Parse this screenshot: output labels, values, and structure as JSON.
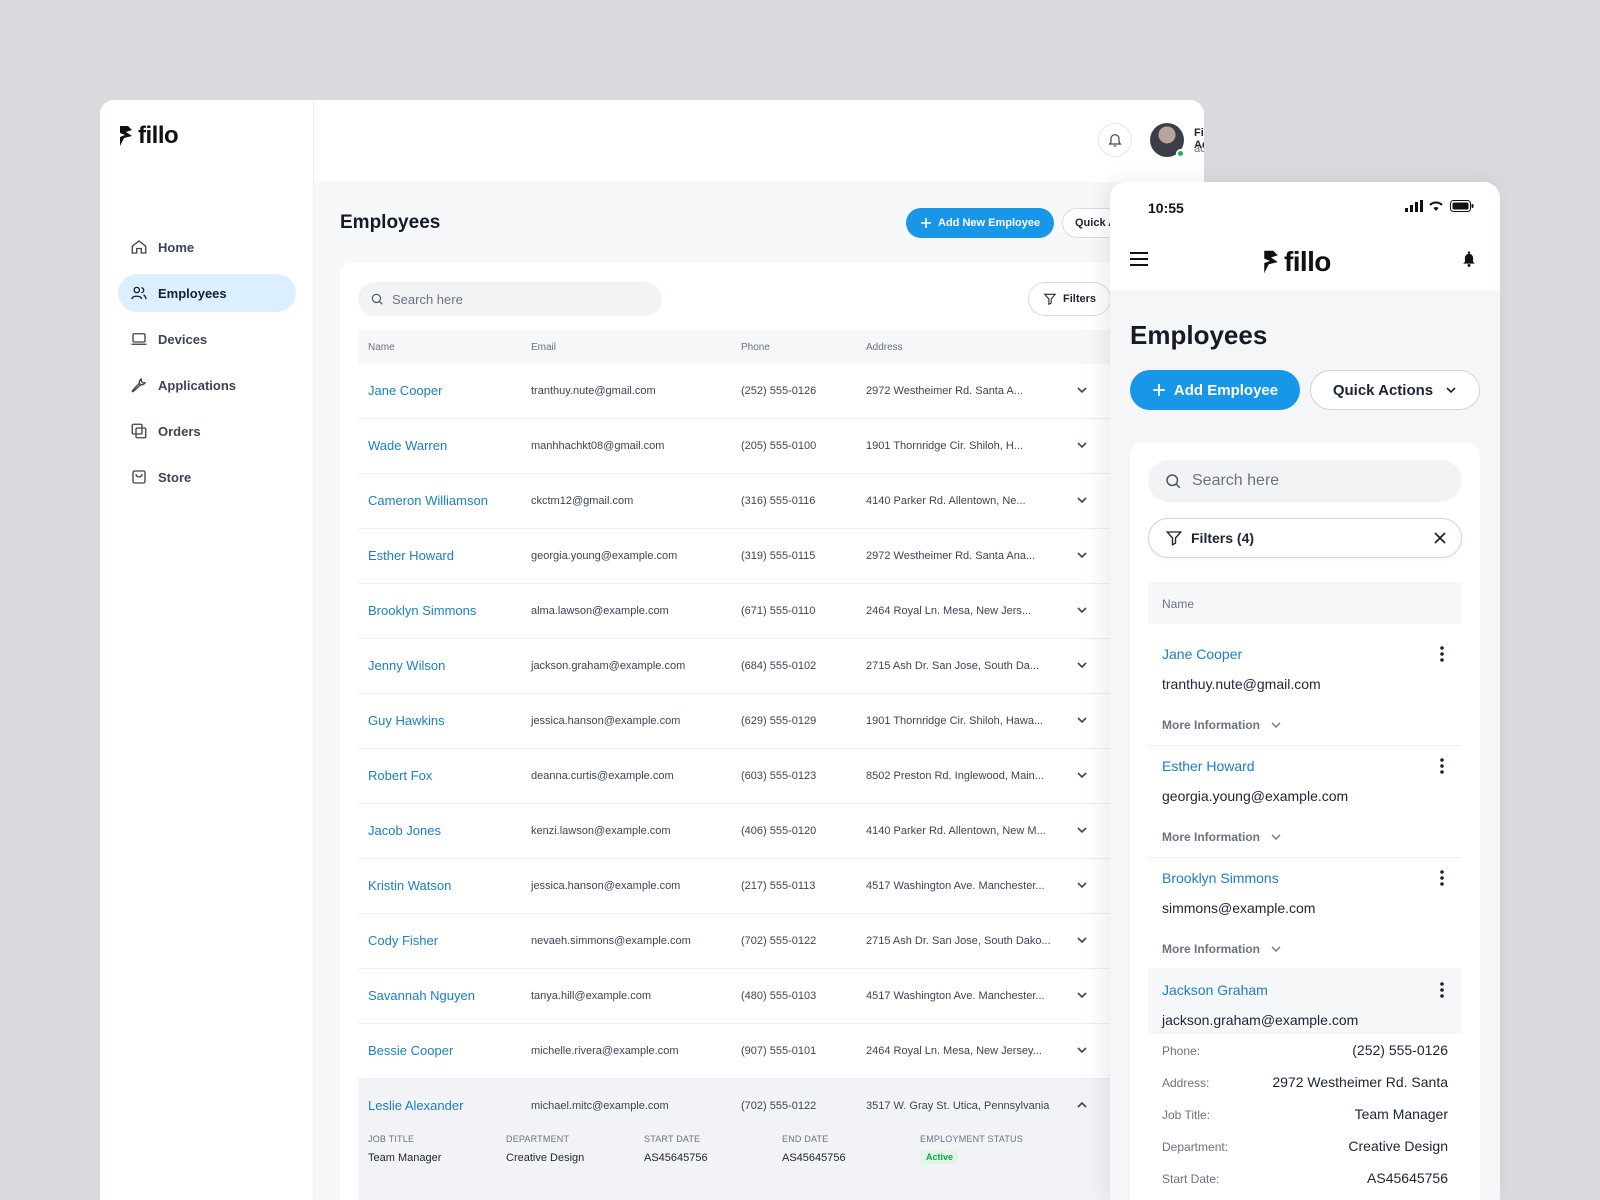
{
  "brand": {
    "name": "fillo",
    "accent": "#1897e8",
    "link": "#1a7fc2"
  },
  "sidebar": {
    "items": [
      {
        "label": "Home",
        "icon": "home-icon",
        "active": false
      },
      {
        "label": "Employees",
        "icon": "users-icon",
        "active": true
      },
      {
        "label": "Devices",
        "icon": "laptop-icon",
        "active": false
      },
      {
        "label": "Applications",
        "icon": "wrench-icon",
        "active": false
      },
      {
        "label": "Orders",
        "icon": "orders-icon",
        "active": false
      },
      {
        "label": "Store",
        "icon": "store-icon",
        "active": false
      }
    ]
  },
  "header": {
    "user_name": "Filllo Admin",
    "user_email": "admin@filllo.com"
  },
  "main": {
    "title": "Employees",
    "add_button": "Add New Employee",
    "quick_button": "Quick A",
    "search_placeholder": "Search here",
    "filters_label": "Filters",
    "columns": [
      "Name",
      "Email",
      "Phone",
      "Address"
    ],
    "rows": [
      {
        "name": "Jane Cooper",
        "email": "tranthuy.nute@gmail.com",
        "phone": "(252) 555-0126",
        "address": "2972 Westheimer Rd. Santa A..."
      },
      {
        "name": "Wade Warren",
        "email": "manhhachkt08@gmail.com",
        "phone": "(205) 555-0100",
        "address": "1901 Thornridge Cir. Shiloh, H..."
      },
      {
        "name": "Cameron Williamson",
        "email": "ckctm12@gmail.com",
        "phone": "(316) 555-0116",
        "address": "4140 Parker Rd. Allentown, Ne..."
      },
      {
        "name": "Esther Howard",
        "email": "georgia.young@example.com",
        "phone": "(319) 555-0115",
        "address": "2972 Westheimer Rd. Santa Ana..."
      },
      {
        "name": "Brooklyn Simmons",
        "email": "alma.lawson@example.com",
        "phone": "(671) 555-0110",
        "address": "2464 Royal Ln. Mesa, New Jers..."
      },
      {
        "name": "Jenny Wilson",
        "email": "jackson.graham@example.com",
        "phone": "(684) 555-0102",
        "address": "2715 Ash Dr. San Jose, South Da..."
      },
      {
        "name": "Guy Hawkins",
        "email": "jessica.hanson@example.com",
        "phone": "(629) 555-0129",
        "address": "1901 Thornridge Cir. Shiloh, Hawa..."
      },
      {
        "name": "Robert Fox",
        "email": "deanna.curtis@example.com",
        "phone": "(603) 555-0123",
        "address": "8502 Preston Rd. Inglewood, Main..."
      },
      {
        "name": "Jacob Jones",
        "email": "kenzi.lawson@example.com",
        "phone": "(406) 555-0120",
        "address": "4140 Parker Rd. Allentown, New M..."
      },
      {
        "name": "Kristin Watson",
        "email": "jessica.hanson@example.com",
        "phone": "(217) 555-0113",
        "address": "4517 Washington Ave. Manchester..."
      },
      {
        "name": "Cody Fisher",
        "email": "nevaeh.simmons@example.com",
        "phone": "(702) 555-0122",
        "address": "2715 Ash Dr. San Jose, South Dako..."
      },
      {
        "name": "Savannah Nguyen",
        "email": "tanya.hill@example.com",
        "phone": "(480) 555-0103",
        "address": "4517 Washington Ave. Manchester..."
      },
      {
        "name": "Bessie Cooper",
        "email": "michelle.rivera@example.com",
        "phone": "(907) 555-0101",
        "address": "2464 Royal Ln. Mesa, New Jersey..."
      },
      {
        "name": "Leslie Alexander",
        "email": "michael.mitc@example.com",
        "phone": "(702) 555-0122",
        "address": "3517 W. Gray St. Utica, Pennsylvania"
      }
    ],
    "detail": {
      "job_title_label": "JOB TITLE",
      "job_title": "Team Manager",
      "department_label": "DEPARTMENT",
      "department": "Creative Design",
      "start_label": "START DATE",
      "start": "AS45645756",
      "end_label": "END DATE",
      "end": "AS45645756",
      "status_label": "EMPLOYMENT STATUS",
      "status": "Active"
    }
  },
  "mobile": {
    "time": "10:55",
    "brand": "fillo",
    "title": "Employees",
    "add_button": "Add Employee",
    "quick_button": "Quick Actions",
    "search_placeholder": "Search here",
    "filters_label": "Filters (4)",
    "column": "Name",
    "more_info": "More Information",
    "items": [
      {
        "name": "Jane Cooper",
        "email": "tranthuy.nute@gmail.com"
      },
      {
        "name": "Esther Howard",
        "email": "georgia.young@example.com"
      },
      {
        "name": "Brooklyn Simmons",
        "email": "simmons@example.com"
      },
      {
        "name": "Jackson Graham",
        "email": "jackson.graham@example.com"
      }
    ],
    "details": [
      {
        "label": "Phone:",
        "value": "(252) 555-0126"
      },
      {
        "label": "Address:",
        "value": "2972 Westheimer Rd. Santa"
      },
      {
        "label": "Job Title:",
        "value": "Team Manager"
      },
      {
        "label": "Department:",
        "value": "Creative Design"
      },
      {
        "label": "Start Date:",
        "value": "AS45645756"
      }
    ]
  }
}
